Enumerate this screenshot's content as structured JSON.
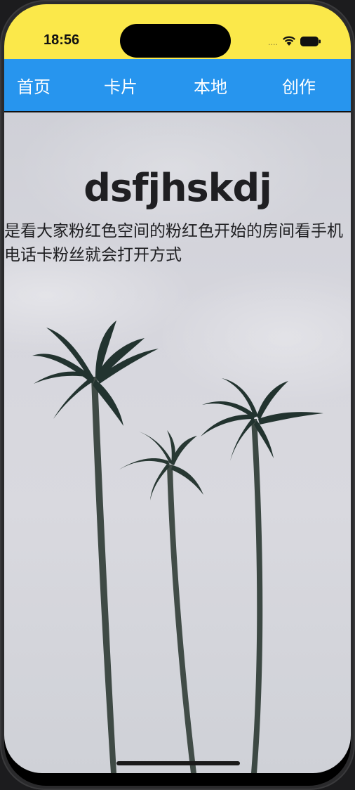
{
  "status_bar": {
    "time": "18:56",
    "signal_text": "....",
    "wifi_icon": "wifi-icon",
    "battery_icon": "battery-icon",
    "background_color": "#fbe84a"
  },
  "nav": {
    "background_color": "#2795ee",
    "items": [
      {
        "label": "首页"
      },
      {
        "label": "卡片"
      },
      {
        "label": "本地"
      },
      {
        "label": "创作"
      }
    ]
  },
  "content": {
    "title": "dsfjhskdj",
    "description": "是看大家粉红色空间的粉红色开始的房间看手机电话卡粉丝就会打开方式"
  }
}
